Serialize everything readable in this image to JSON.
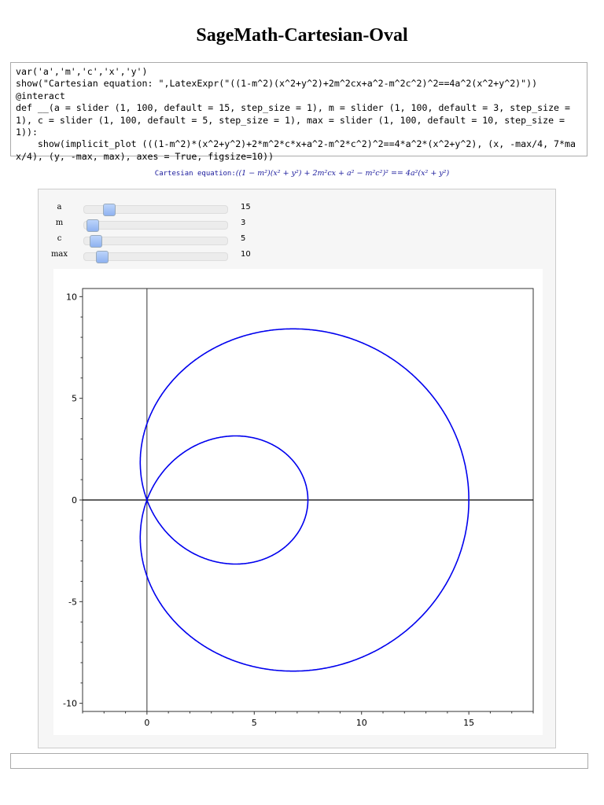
{
  "title": "SageMath-Cartesian-Oval",
  "code_lines": [
    "var('a','m','c','x','y')",
    "show(\"Cartesian equation: \",LatexExpr(\"((1-m^2)(x^2+y^2)+2m^2cx+a^2-m^2c^2)^2==4a^2(x^2+y^2)\"))",
    "@interact",
    "def __(a = slider (1, 100, default = 15, step_size = 1), m = slider (1, 100, default = 3, step_size = 1), c = slider (1, 100, default = 5, step_size = 1), max = slider (1, 100, default = 10, step_size = 1)):",
    "    show(implicit_plot (((1-m^2)*(x^2+y^2)+2*m^2*c*x+a^2-m^2*c^2)^2==4*a^2*(x^2+y^2), (x, -max/4, 7*max/4), (y, -max, max), axes = True, figsize=10))"
  ],
  "output": {
    "label": "Cartesian equation:",
    "equation": "((1 − m²)(x² + y²) + 2m²cx + a² − m²c²)² == 4a²(x² + y²)"
  },
  "sliders": [
    {
      "name": "a",
      "value": "15",
      "min": 1,
      "max": 100,
      "current": 15
    },
    {
      "name": "m",
      "value": "3",
      "min": 1,
      "max": 100,
      "current": 3
    },
    {
      "name": "c",
      "value": "5",
      "min": 1,
      "max": 100,
      "current": 5
    },
    {
      "name": "max",
      "value": "10",
      "min": 1,
      "max": 100,
      "current": 10
    }
  ],
  "chart_data": {
    "type": "line",
    "title": "",
    "equation": "((1-m^2)*(x^2+y^2)+2*m^2*c*x+a^2-m^2*c^2)^2 == 4*a^2*(x^2+y^2)",
    "params": {
      "a": 15,
      "m": 3,
      "c": 5
    },
    "xlim": [
      -3,
      18
    ],
    "ylim": [
      -10.4,
      10.4
    ],
    "xticks": [
      0,
      5,
      10,
      15
    ],
    "yticks": [
      -10,
      -5,
      0,
      5,
      10
    ],
    "xtick_labels": [
      "0",
      "5",
      "10",
      "15"
    ],
    "ytick_labels": [
      "-10",
      "-5",
      "0",
      "5",
      "10"
    ],
    "curve_color": "#0000ee",
    "grid": false
  }
}
